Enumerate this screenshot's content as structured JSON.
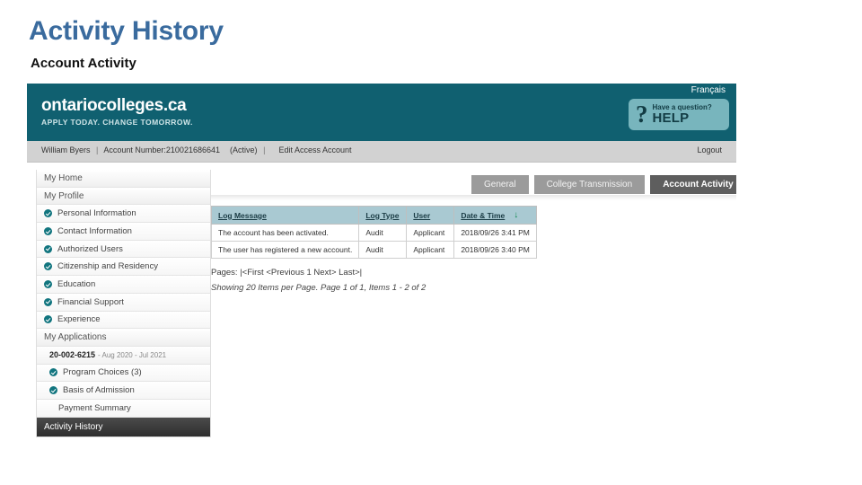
{
  "slide": {
    "title": "Activity History",
    "subtitle": "Account Activity",
    "title_color": "#3a6b9e"
  },
  "site": {
    "logo_main": "ontariocolleges.ca",
    "logo_tagline": "APPLY TODAY. CHANGE TOMORROW.",
    "language_link": "Français",
    "help": {
      "icon": "question-mark-icon",
      "small_text": "Have a question?",
      "big_text": "HELP"
    },
    "header_color": "#106070",
    "help_box_color": "#78b5bd"
  },
  "account_bar": {
    "user_name": "William Byers",
    "separator": "|",
    "account_number": "Account Number:210021686641",
    "status": "(Active)",
    "edit_link": "Edit Access Account",
    "logout": "Logout"
  },
  "sidebar": {
    "items": [
      {
        "label": "My Home",
        "type": "section",
        "checked": false
      },
      {
        "label": "My Profile",
        "type": "section",
        "checked": false
      },
      {
        "label": "Personal Information",
        "type": "item",
        "checked": true
      },
      {
        "label": "Contact Information",
        "type": "item",
        "checked": true
      },
      {
        "label": "Authorized Users",
        "type": "item",
        "checked": true
      },
      {
        "label": "Citizenship and Residency",
        "type": "item",
        "checked": true
      },
      {
        "label": "Education",
        "type": "item",
        "checked": true
      },
      {
        "label": "Financial Support",
        "type": "item",
        "checked": true
      },
      {
        "label": "Experience",
        "type": "item",
        "checked": true
      },
      {
        "label": "My Applications",
        "type": "section",
        "checked": false
      }
    ],
    "application": {
      "id": "20-002-6215",
      "dates": "- Aug 2020 - Jul 2021"
    },
    "application_items": [
      {
        "label": "Program Choices (3)",
        "checked": true
      },
      {
        "label": "Basis of Admission",
        "checked": true
      },
      {
        "label": "Payment Summary",
        "checked": false
      }
    ],
    "active_item": "Activity History"
  },
  "tabs": [
    {
      "label": "General",
      "active": false
    },
    {
      "label": "College Transmission",
      "active": false
    },
    {
      "label": "Account Activity",
      "active": true
    }
  ],
  "table": {
    "columns": [
      {
        "label": "Log Message",
        "sorted": false
      },
      {
        "label": "Log Type",
        "sorted": false
      },
      {
        "label": "User",
        "sorted": false
      },
      {
        "label": "Date & Time",
        "sorted": true
      }
    ],
    "sort_icon": "↓",
    "sort_icon_color": "#0f8a4f",
    "header_color": "#a9c9d2",
    "rows": [
      {
        "message": "The account has been activated.",
        "log_type": "Audit",
        "user": "Applicant",
        "datetime": "2018/09/26 3:41 PM"
      },
      {
        "message": "The user has registered a new account.",
        "log_type": "Audit",
        "user": "Applicant",
        "datetime": "2018/09/26 3:40 PM"
      }
    ]
  },
  "pagination": {
    "label": "Pages:",
    "links": "|<First <Previous 1 Next> Last>|",
    "showing": "Showing 20 Items per Page. Page 1 of 1, Items 1 - 2 of 2"
  }
}
